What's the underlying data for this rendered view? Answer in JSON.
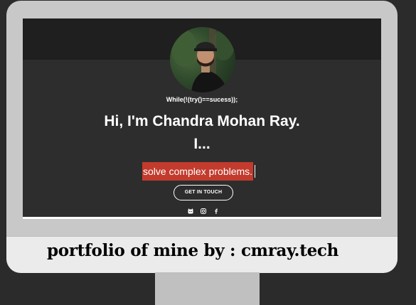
{
  "screen": {
    "tagline": "While(!(try()==sucess));",
    "headline": "Hi, I'm Chandra Mohan Ray.",
    "headline_2": "I...",
    "typed_text": "solve complex problems.",
    "cta_label": "GET IN TOUCH",
    "socials": [
      "github-icon",
      "instagram-icon",
      "facebook-icon"
    ],
    "colors": {
      "highlight": "#c23b2d",
      "background": "#2d2d2d"
    }
  },
  "caption": "portfolio  of mine by : cmray.tech"
}
